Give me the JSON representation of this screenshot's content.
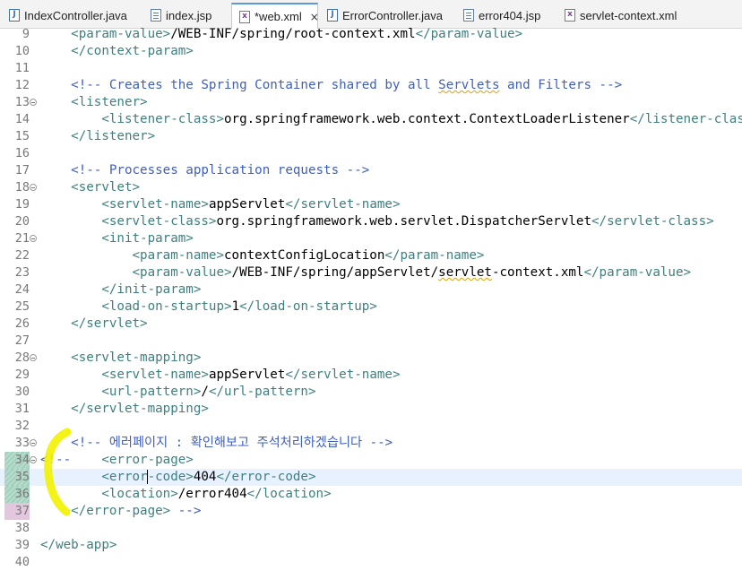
{
  "tabs": [
    {
      "label": "IndexController.java",
      "icon": "java-file-icon",
      "active": false
    },
    {
      "label": "index.jsp",
      "icon": "jsp-file-icon",
      "active": false
    },
    {
      "label": "*web.xml",
      "icon": "xml-file-icon",
      "active": true,
      "close": "×"
    },
    {
      "label": "ErrorController.java",
      "icon": "java-file-icon",
      "active": false
    },
    {
      "label": "error404.jsp",
      "icon": "jsp-file-icon",
      "active": false
    },
    {
      "label": "servlet-context.xml",
      "icon": "xml-file-icon",
      "active": false
    }
  ],
  "lines": [
    {
      "n": "9",
      "code": [
        [
          "    ",
          ""
        ],
        [
          "<param-value>",
          "t"
        ],
        [
          "/WEB-INF/spring/root-context.xml",
          ""
        ],
        [
          "</param-value>",
          "t"
        ]
      ]
    },
    {
      "n": "10",
      "code": [
        [
          "    ",
          ""
        ],
        [
          "</context-param>",
          "t"
        ]
      ]
    },
    {
      "n": "11",
      "code": []
    },
    {
      "n": "12",
      "code": [
        [
          "    ",
          ""
        ],
        [
          "<!-- Creates the Spring Container shared by all ",
          "c"
        ],
        [
          "Servlets",
          "c sq"
        ],
        [
          " and Filters -->",
          "c"
        ]
      ]
    },
    {
      "n": "13",
      "fold": true,
      "code": [
        [
          "    ",
          ""
        ],
        [
          "<listener>",
          "t"
        ]
      ]
    },
    {
      "n": "14",
      "code": [
        [
          "        ",
          ""
        ],
        [
          "<listener-class>",
          "t"
        ],
        [
          "org.springframework.web.context.ContextLoaderListener",
          ""
        ],
        [
          "</listener-class>",
          "t"
        ]
      ]
    },
    {
      "n": "15",
      "code": [
        [
          "    ",
          ""
        ],
        [
          "</listener>",
          "t"
        ]
      ]
    },
    {
      "n": "16",
      "code": []
    },
    {
      "n": "17",
      "code": [
        [
          "    ",
          ""
        ],
        [
          "<!-- Processes application requests -->",
          "c"
        ]
      ]
    },
    {
      "n": "18",
      "fold": true,
      "code": [
        [
          "    ",
          ""
        ],
        [
          "<servlet>",
          "t"
        ]
      ]
    },
    {
      "n": "19",
      "code": [
        [
          "        ",
          ""
        ],
        [
          "<servlet-name>",
          "t"
        ],
        [
          "appServlet",
          ""
        ],
        [
          "</servlet-name>",
          "t"
        ]
      ]
    },
    {
      "n": "20",
      "code": [
        [
          "        ",
          ""
        ],
        [
          "<servlet-class>",
          "t"
        ],
        [
          "org.springframework.web.servlet.DispatcherServlet",
          ""
        ],
        [
          "</servlet-class>",
          "t"
        ]
      ]
    },
    {
      "n": "21",
      "fold": true,
      "code": [
        [
          "        ",
          ""
        ],
        [
          "<init-param>",
          "t"
        ]
      ]
    },
    {
      "n": "22",
      "code": [
        [
          "            ",
          ""
        ],
        [
          "<param-name>",
          "t"
        ],
        [
          "contextConfigLocation",
          ""
        ],
        [
          "</param-name>",
          "t"
        ]
      ]
    },
    {
      "n": "23",
      "code": [
        [
          "            ",
          ""
        ],
        [
          "<param-value>",
          "t"
        ],
        [
          "/WEB-INF/spring/appServlet/",
          ""
        ],
        [
          "servlet",
          "sq"
        ],
        [
          "-context.xml",
          ""
        ],
        [
          "</param-value>",
          "t"
        ]
      ]
    },
    {
      "n": "24",
      "code": [
        [
          "        ",
          ""
        ],
        [
          "</init-param>",
          "t"
        ]
      ]
    },
    {
      "n": "25",
      "code": [
        [
          "        ",
          ""
        ],
        [
          "<load-on-startup>",
          "t"
        ],
        [
          "1",
          ""
        ],
        [
          "</load-on-startup>",
          "t"
        ]
      ]
    },
    {
      "n": "26",
      "code": [
        [
          "    ",
          ""
        ],
        [
          "</servlet>",
          "t"
        ]
      ]
    },
    {
      "n": "27",
      "code": []
    },
    {
      "n": "28",
      "fold": true,
      "code": [
        [
          "    ",
          ""
        ],
        [
          "<servlet-mapping>",
          "t"
        ]
      ]
    },
    {
      "n": "29",
      "code": [
        [
          "        ",
          ""
        ],
        [
          "<servlet-name>",
          "t"
        ],
        [
          "appServlet",
          ""
        ],
        [
          "</servlet-name>",
          "t"
        ]
      ]
    },
    {
      "n": "30",
      "code": [
        [
          "        ",
          ""
        ],
        [
          "<url-pattern>",
          "t"
        ],
        [
          "/",
          ""
        ],
        [
          "</url-pattern>",
          "t"
        ]
      ]
    },
    {
      "n": "31",
      "code": [
        [
          "    ",
          ""
        ],
        [
          "</servlet-mapping>",
          "t"
        ]
      ]
    },
    {
      "n": "32",
      "code": []
    },
    {
      "n": "33",
      "fold": true,
      "code": [
        [
          "    ",
          ""
        ],
        [
          "<!-- 에러페이지 : 확인해보고 주석처리하겠습니다 -->",
          "c"
        ]
      ]
    },
    {
      "n": "34",
      "fold": true,
      "quick": true,
      "code": [
        [
          "<!--",
          "c"
        ],
        [
          "    ",
          ""
        ],
        [
          "<error-page>",
          "t"
        ]
      ]
    },
    {
      "n": "35",
      "quick": true,
      "current": true,
      "code": [
        [
          "        ",
          ""
        ],
        [
          "<error",
          "t"
        ],
        [
          "-code>",
          "t caret"
        ],
        [
          "404",
          ""
        ],
        [
          "</error-code>",
          "t"
        ]
      ]
    },
    {
      "n": "36",
      "quick": true,
      "code": [
        [
          "        ",
          ""
        ],
        [
          "<location>",
          "t"
        ],
        [
          "/error404",
          ""
        ],
        [
          "</location>",
          "t"
        ]
      ]
    },
    {
      "n": "37",
      "quick": true,
      "edge": true,
      "code": [
        [
          "    ",
          ""
        ],
        [
          "</error-page>",
          "t"
        ],
        [
          " -->",
          "c"
        ]
      ]
    },
    {
      "n": "38",
      "code": []
    },
    {
      "n": "39",
      "code": [
        [
          "",
          ""
        ],
        [
          "</web-app>",
          "t"
        ]
      ]
    },
    {
      "n": "40",
      "code": []
    }
  ],
  "colors": {
    "tag": "#3f7f7f",
    "comment": "#3f5fbf",
    "annotation": "#f2f200",
    "current_line": "#e8f2fe"
  }
}
